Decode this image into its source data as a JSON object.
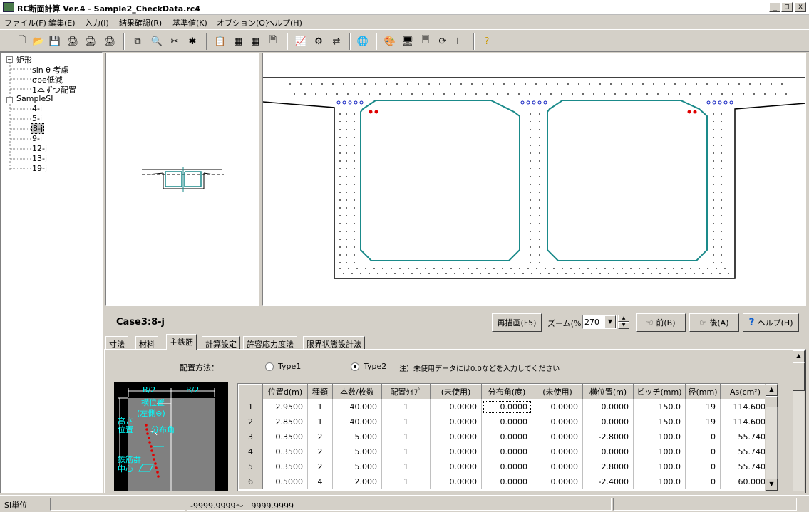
{
  "window": {
    "title": "RC断面計算 Ver.4 - Sample2_CheckData.rc4",
    "min": "_",
    "max": "□",
    "close": "x"
  },
  "menu": [
    "ファイル(F)",
    "編集(E)",
    "入力(I)",
    "結果確認(R)",
    "基準値(K)",
    "オプション(O)",
    "ヘルプ(H)"
  ],
  "toolbar_icons": [
    "new-icon",
    "open-icon",
    "save-icon",
    "print-icon",
    "print-preview-icon",
    "print-setup-icon",
    "copy-section-icon",
    "find-icon",
    "delete-icon",
    "check-icon",
    "input-form-icon",
    "table-icon",
    "table2-icon",
    "result-icon",
    "chart-icon",
    "calc-icon",
    "transfer-icon",
    "web-icon",
    "color-icon",
    "monitor-icon",
    "output-icon",
    "refresh-icon",
    "tree-icon",
    "help-icon"
  ],
  "tree": {
    "groups": [
      {
        "label": "矩形",
        "children": [
          "sin θ 考慮",
          "σpe低減",
          "1本ずつ配置"
        ]
      },
      {
        "label": "SampleSI",
        "children": [
          "4-i",
          "5-i",
          "8-j",
          "9-i",
          "12-j",
          "13-j",
          "19-j"
        ]
      }
    ],
    "selected": "8-j"
  },
  "case_label": "Case3:8-j",
  "buttons": {
    "redraw": "再描画(F5)",
    "zoom_label": "ズーム(%)",
    "zoom_value": "270",
    "prev": "前(B)",
    "next": "後(A)",
    "help": "ヘルプ(H)"
  },
  "tabs": [
    "寸法",
    "材料",
    "主鉄筋",
    "計算設定",
    "許容応力度法",
    "限界状態設計法"
  ],
  "active_tab": "主鉄筋",
  "placement": {
    "label": "配置方法：",
    "option1": "Type1",
    "option2": "Type2",
    "selected": "Type2",
    "note": "注）未使用データには0.0などを入力してください"
  },
  "diagram": {
    "b_half_left": "B/2",
    "b_half_right": "B/2",
    "horiz_pos": "横位置",
    "left_neg": "(左側⊖)",
    "height_pos": "高さ",
    "height_pos2": "位置",
    "dist_angle": "分布角",
    "bar_group": "鉄筋群",
    "center": "中心"
  },
  "grid": {
    "columns": [
      "位置d(m)",
      "種類",
      "本数/枚数",
      "配置ﾀｲﾌﾟ",
      "(未使用)",
      "分布角(度)",
      "(未使用)",
      "横位置(m)",
      "ピッチ(mm)",
      "径(mm)",
      "As(cm²)"
    ],
    "rows": [
      {
        "n": "1",
        "cells": [
          "2.9500",
          "1",
          "40.000",
          "1",
          "0.0000",
          "0.0000",
          "0.0000",
          "0.0000",
          "150.0",
          "19",
          "114.600"
        ]
      },
      {
        "n": "2",
        "cells": [
          "2.8500",
          "1",
          "40.000",
          "1",
          "0.0000",
          "0.0000",
          "0.0000",
          "0.0000",
          "150.0",
          "19",
          "114.600"
        ]
      },
      {
        "n": "3",
        "cells": [
          "0.3500",
          "2",
          "5.000",
          "1",
          "0.0000",
          "0.0000",
          "0.0000",
          "-2.8000",
          "100.0",
          "0",
          "55.740"
        ]
      },
      {
        "n": "4",
        "cells": [
          "0.3500",
          "2",
          "5.000",
          "1",
          "0.0000",
          "0.0000",
          "0.0000",
          "0.0000",
          "100.0",
          "0",
          "55.740"
        ]
      },
      {
        "n": "5",
        "cells": [
          "0.3500",
          "2",
          "5.000",
          "1",
          "0.0000",
          "0.0000",
          "0.0000",
          "2.8000",
          "100.0",
          "0",
          "55.740"
        ]
      },
      {
        "n": "6",
        "cells": [
          "0.5000",
          "4",
          "2.000",
          "1",
          "0.0000",
          "0.0000",
          "0.0000",
          "-2.4000",
          "100.0",
          "0",
          "60.000"
        ]
      }
    ]
  },
  "status": {
    "unit": "SI単位",
    "range": "-9999.9999～　9999.9999"
  },
  "colors": {
    "section_outline": "#1a8a8a",
    "rebar_red": "#e00000",
    "rebar_blue": "#1020c0",
    "diagram_bg": "#808080",
    "diagram_text": "#00ffff"
  }
}
